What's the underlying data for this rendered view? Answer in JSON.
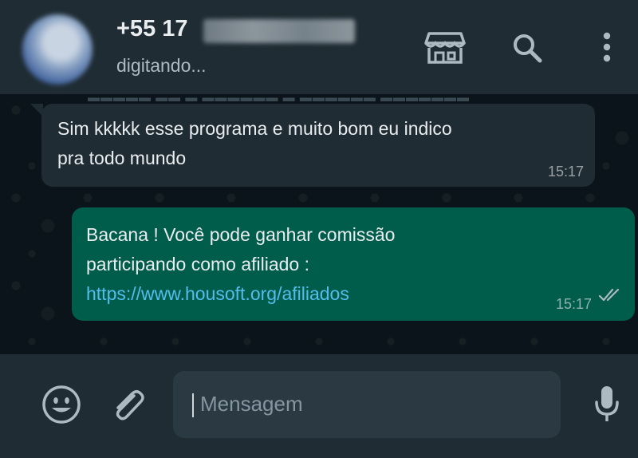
{
  "header": {
    "contact_name": "+55 17",
    "contact_status": "digitando...",
    "icons": [
      "avatar",
      "catalog-store-icon",
      "search-icon",
      "more-options-icon"
    ]
  },
  "chat": {
    "messages": [
      {
        "direction": "incoming",
        "lines": [
          "Sim kkkkk esse programa e muito bom eu indico",
          "pra todo mundo"
        ],
        "time": "15:17"
      },
      {
        "direction": "outgoing",
        "lines": [
          "Bacana ! Você pode ganhar comissão",
          "participando como afiliado :"
        ],
        "link": "https://www.housoft.org/afiliados",
        "time": "15:17",
        "status": "delivered-double-check"
      }
    ]
  },
  "footer": {
    "input_placeholder": "Mensagem",
    "icons": [
      "emoji-icon",
      "attach-icon",
      "microphone-icon"
    ]
  },
  "colors": {
    "header_bg": "#1f2c33",
    "chat_bg": "#0b141a",
    "incoming_bubble": "#1f2c33",
    "outgoing_bubble": "#005c4b",
    "link": "#53bdeb",
    "input_bg": "#2a3942"
  }
}
